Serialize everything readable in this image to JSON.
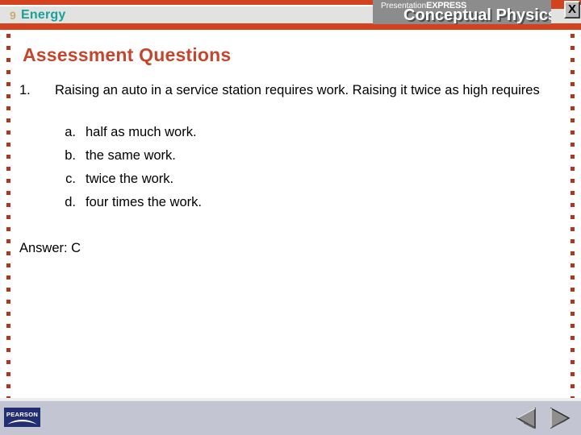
{
  "header": {
    "chapter_number": "9",
    "chapter_title": "Energy",
    "brand_line1_light": "Presentation",
    "brand_line1_bold": "EXPRESS",
    "brand_line2": "Conceptual Physics",
    "close_label": "X",
    "rule_color": "#d2421e",
    "chapter_title_color": "#15a29a",
    "chapter_number_color": "#c8ab73",
    "banner_color": "#8c8c8c"
  },
  "slide": {
    "title": "Assessment Questions",
    "title_color": "#c4462c",
    "dot_color": "#b5331f",
    "questions": [
      {
        "number": "1.",
        "text": "Raising an auto in a service station requires work. Raising it twice as high requires",
        "choices": [
          {
            "letter": "a.",
            "text": "half as much work."
          },
          {
            "letter": "b.",
            "text": "the same work."
          },
          {
            "letter": "c.",
            "text": "twice the work."
          },
          {
            "letter": "d.",
            "text": "four times the work."
          }
        ]
      }
    ],
    "answer": "Answer: C"
  },
  "footer": {
    "logo_text": "PEARSON",
    "logo_color": "#232e72",
    "background_color": "#c3c5d2",
    "prev_label": "previous-slide",
    "next_label": "next-slide"
  }
}
